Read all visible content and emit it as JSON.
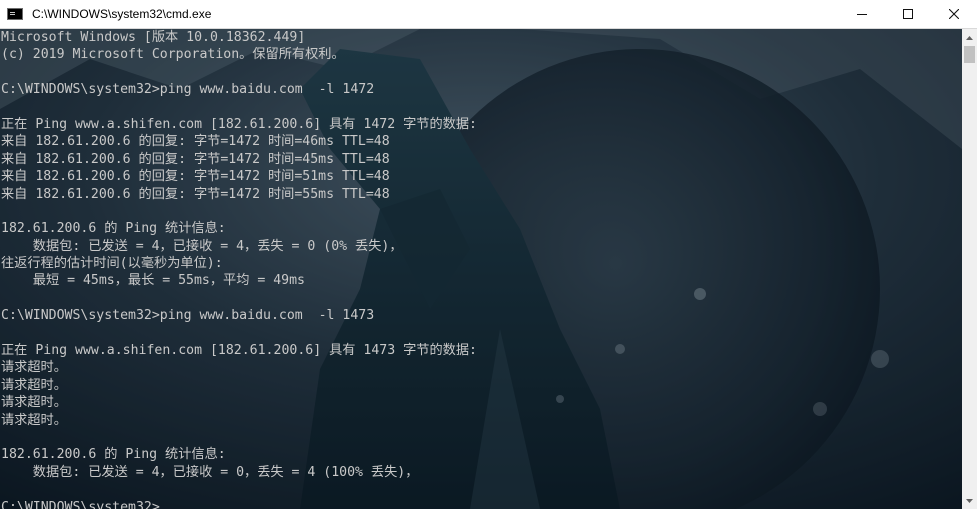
{
  "window": {
    "title": "C:\\WINDOWS\\system32\\cmd.exe",
    "minimize_glyph": "minimize-icon",
    "maximize_glyph": "maximize-icon",
    "close_glyph": "close-icon"
  },
  "console": {
    "lines": [
      "Microsoft Windows [版本 10.0.18362.449]",
      "(c) 2019 Microsoft Corporation。保留所有权利。",
      "",
      "C:\\WINDOWS\\system32>ping www.baidu.com  -l 1472",
      "",
      "正在 Ping www.a.shifen.com [182.61.200.6] 具有 1472 字节的数据:",
      "来自 182.61.200.6 的回复: 字节=1472 时间=46ms TTL=48",
      "来自 182.61.200.6 的回复: 字节=1472 时间=45ms TTL=48",
      "来自 182.61.200.6 的回复: 字节=1472 时间=51ms TTL=48",
      "来自 182.61.200.6 的回复: 字节=1472 时间=55ms TTL=48",
      "",
      "182.61.200.6 的 Ping 统计信息:",
      "    数据包: 已发送 = 4，已接收 = 4，丢失 = 0 (0% 丢失)，",
      "往返行程的估计时间(以毫秒为单位):",
      "    最短 = 45ms，最长 = 55ms，平均 = 49ms",
      "",
      "C:\\WINDOWS\\system32>ping www.baidu.com  -l 1473",
      "",
      "正在 Ping www.a.shifen.com [182.61.200.6] 具有 1473 字节的数据:",
      "请求超时。",
      "请求超时。",
      "请求超时。",
      "请求超时。",
      "",
      "182.61.200.6 的 Ping 统计信息:",
      "    数据包: 已发送 = 4，已接收 = 0，丢失 = 4 (100% 丢失)，",
      ""
    ],
    "prompt": "C:\\WINDOWS\\system32>"
  },
  "colors": {
    "text": "#c9c9c9",
    "background": "#0e1a26",
    "titlebar": "#ffffff"
  }
}
